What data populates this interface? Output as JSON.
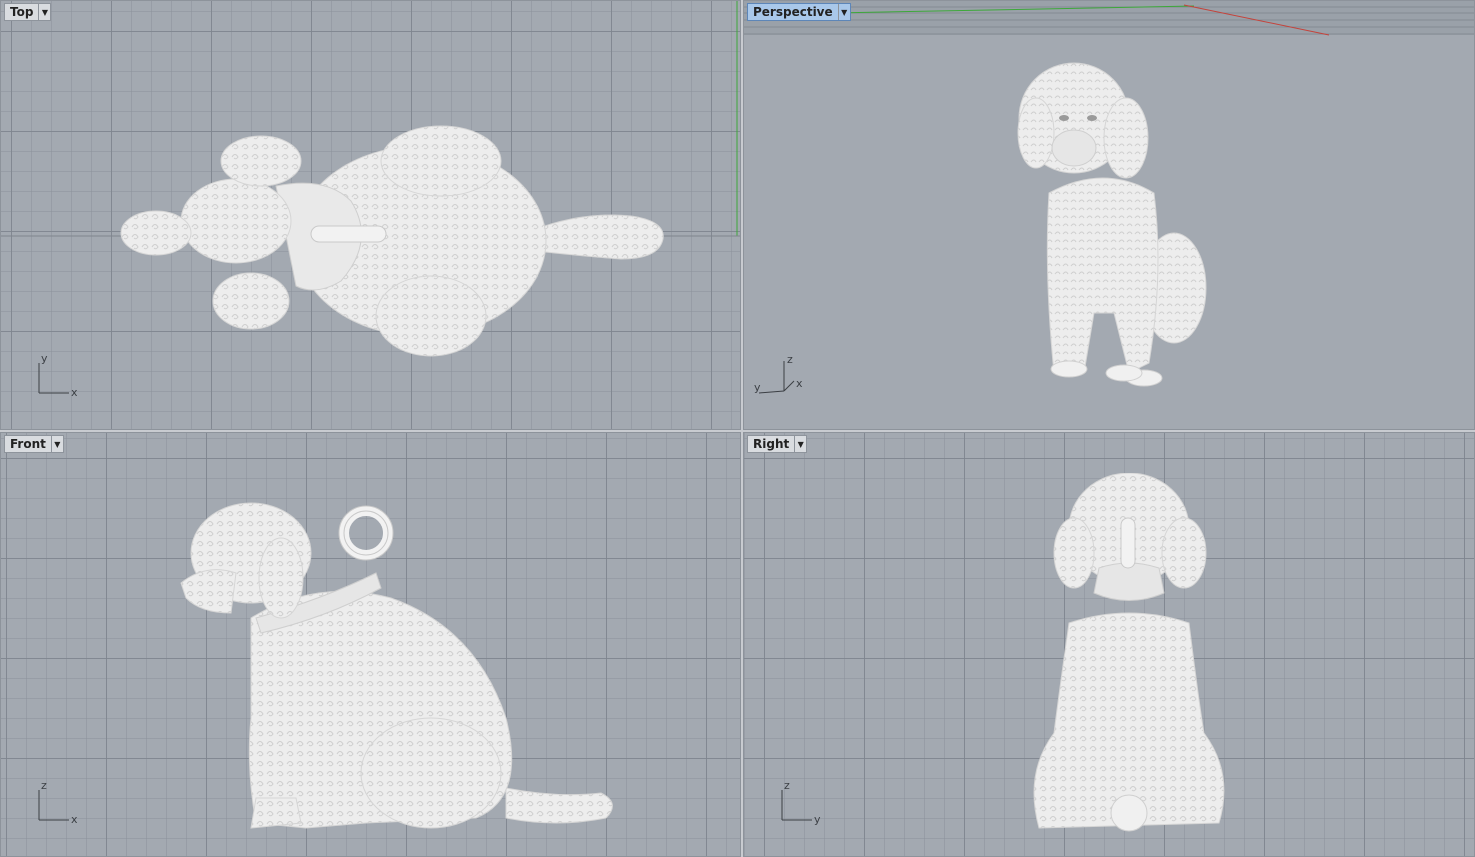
{
  "viewports": {
    "top": {
      "label": "Top",
      "axes": [
        "y",
        "x"
      ]
    },
    "perspective": {
      "label": "Perspective",
      "axes": [
        "z",
        "y",
        "x"
      ]
    },
    "front": {
      "label": "Front",
      "axes": [
        "z",
        "x"
      ]
    },
    "right": {
      "label": "Right",
      "axes": [
        "z",
        "y"
      ]
    }
  },
  "icons": {
    "dropdown": "chevron-down-icon"
  },
  "colors": {
    "viewport_bg": "#a3a9b1",
    "active_label_bg": "#a9c8ea",
    "model_fill": "#f2f2f2",
    "x_axis": "#c4433b",
    "y_axis": "#3da83a"
  }
}
